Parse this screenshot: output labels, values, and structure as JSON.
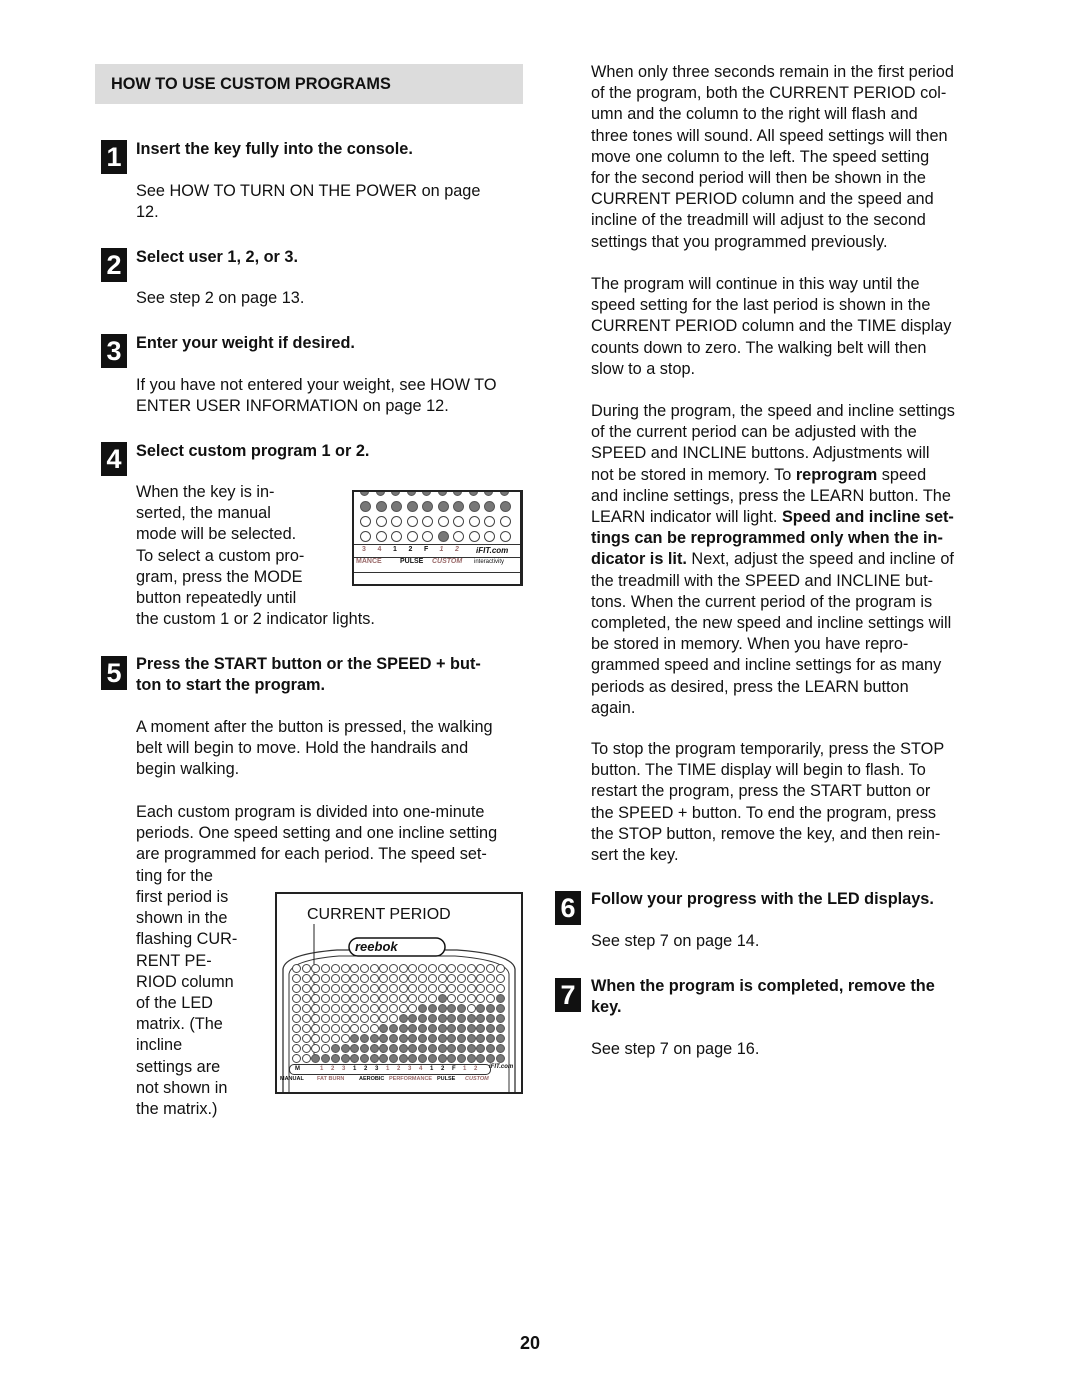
{
  "section": {
    "title": "HOW TO USE CUSTOM PROGRAMS"
  },
  "steps": [
    {
      "number": "1",
      "title": "Insert the key fully into the console.",
      "body": [
        "See HOW TO TURN ON THE POWER on page",
        "12."
      ]
    },
    {
      "number": "2",
      "title": "Select user 1, 2, or 3.",
      "body": [
        "See step 2 on page 13."
      ]
    },
    {
      "number": "3",
      "title": "Enter your weight if desired.",
      "body": [
        "If you have not entered your weight, see HOW TO",
        "ENTER USER INFORMATION on page 12."
      ]
    },
    {
      "number": "4",
      "title": "Select custom program 1 or 2.",
      "body": [
        "When the key is in-",
        "serted, the manual",
        "mode will be selected.",
        "To select a custom pro-",
        "gram, press the MODE",
        "button repeatedly until",
        "the custom 1 or 2 indicator lights."
      ]
    },
    {
      "number": "5",
      "title": [
        "Press the START button or the SPEED + but-",
        "ton to start the program."
      ],
      "body": [
        "A moment after the button is pressed, the walking",
        "belt will begin to move. Hold the handrails and",
        "begin walking."
      ]
    },
    {
      "number": "6",
      "title": "Follow your progress with the LED displays.",
      "body": [
        "See step 7 on page 14."
      ]
    },
    {
      "number": "7",
      "title": [
        "When the program is completed, remove the",
        "key."
      ],
      "body": [
        "See step 7 on page 16."
      ]
    }
  ],
  "left_extra": {
    "para_a": [
      "Each custom program is divided into one-minute",
      "periods. One speed setting and one incline setting",
      "are programmed for each period. The speed set-",
      "ting for the"
    ],
    "para_b": [
      "first period is",
      "shown in the",
      "flashing CUR-",
      "RENT PE-",
      "RIOD column",
      "of the LED",
      "matrix. (The",
      "incline",
      "settings are",
      "not shown in",
      "the matrix.)"
    ]
  },
  "right": {
    "p1": [
      "When only three seconds remain in the first period",
      "of the program, both the CURRENT PERIOD col-",
      "umn and the column to the right will flash and",
      "three tones will sound. All speed settings will then",
      "move one column to the left. The speed setting",
      "for the second period will then be shown in the",
      "CURRENT PERIOD column and the speed and",
      "incline of the treadmill will adjust to the second",
      "settings that you programmed previously."
    ],
    "p2": [
      "The program will continue in this way until the",
      "speed setting for the last period is shown in the",
      "CURRENT PERIOD column and the TIME display",
      "counts down to zero. The walking belt will then",
      "slow to a stop."
    ],
    "p3_lines": [
      [
        {
          "t": "During the program, the speed and incline settings"
        }
      ],
      [
        {
          "t": "of the current period can be adjusted with the"
        }
      ],
      [
        {
          "t": "SPEED and INCLINE buttons. Adjustments will"
        }
      ],
      [
        {
          "t": "not be stored in memory. To "
        },
        {
          "t": "reprogram",
          "b": true
        },
        {
          "t": " speed"
        }
      ],
      [
        {
          "t": "and incline settings, press the LEARN button. The"
        }
      ],
      [
        {
          "t": "LEARN indicator will light. "
        },
        {
          "t": "Speed and incline set-",
          "b": true
        }
      ],
      [
        {
          "t": "tings can be reprogrammed only when the in-",
          "b": true
        }
      ],
      [
        {
          "t": "dicator is lit.",
          "b": true
        },
        {
          "t": " Next, adjust the speed and incline of"
        }
      ],
      [
        {
          "t": "the treadmill with the SPEED and INCLINE but-"
        }
      ],
      [
        {
          "t": "tons. When the current period of the program is"
        }
      ],
      [
        {
          "t": "completed, the new speed and incline settings will"
        }
      ],
      [
        {
          "t": "be stored in memory. When you have repro-"
        }
      ],
      [
        {
          "t": "grammed speed and incline settings for as many"
        }
      ],
      [
        {
          "t": "periods as desired, press the LEARN button"
        }
      ],
      [
        {
          "t": "again."
        }
      ]
    ],
    "p4": [
      "To stop the program temporarily, press the STOP",
      "button. The TIME display will begin to flash. To",
      "restart the program, press the START button or",
      "the SPEED + button. To end the program, press",
      "the STOP button, remove the key, and then rein-",
      "sert the key."
    ]
  },
  "figure_small": {
    "indices": [
      "3",
      "4",
      "1",
      "2",
      "F",
      "1",
      "2"
    ],
    "groups": [
      "MANCE",
      "PULSE",
      "CUSTOM"
    ],
    "brand": "iFIT.com",
    "brand_sub": "interactivity",
    "rows": [
      [
        1,
        1,
        1,
        1,
        1,
        1,
        1,
        1,
        1,
        1
      ],
      [
        0,
        0,
        0,
        0,
        0,
        0,
        0,
        0,
        0,
        0
      ],
      [
        0,
        0,
        0,
        0,
        0,
        1,
        0,
        0,
        0,
        0
      ]
    ]
  },
  "figure_matrix": {
    "label": "CURRENT PERIOD",
    "brand": "reebok",
    "columns": 22,
    "rows": 10,
    "current_period_column": 3,
    "column_heights": [
      0,
      0,
      1,
      1,
      2,
      2,
      3,
      3,
      3,
      4,
      4,
      5,
      5,
      6,
      6,
      7,
      6,
      6,
      5,
      6,
      6,
      7
    ],
    "indices": [
      "M",
      "1",
      "2",
      "3",
      "1",
      "2",
      "3",
      "1",
      "2",
      "3",
      "4",
      "1",
      "2",
      "F",
      "1",
      "2"
    ],
    "groups": [
      "MANUAL",
      "FAT BURN",
      "AEROBIC",
      "PERFORMANCE",
      "PULSE",
      "CUSTOM"
    ],
    "brand_sub": "iFIT.com"
  },
  "footer": {
    "page_number": "20"
  },
  "colors": {
    "header_bg": "#dcdcdc",
    "led_on": "#777777",
    "custom_label": "#8a6a6a"
  }
}
